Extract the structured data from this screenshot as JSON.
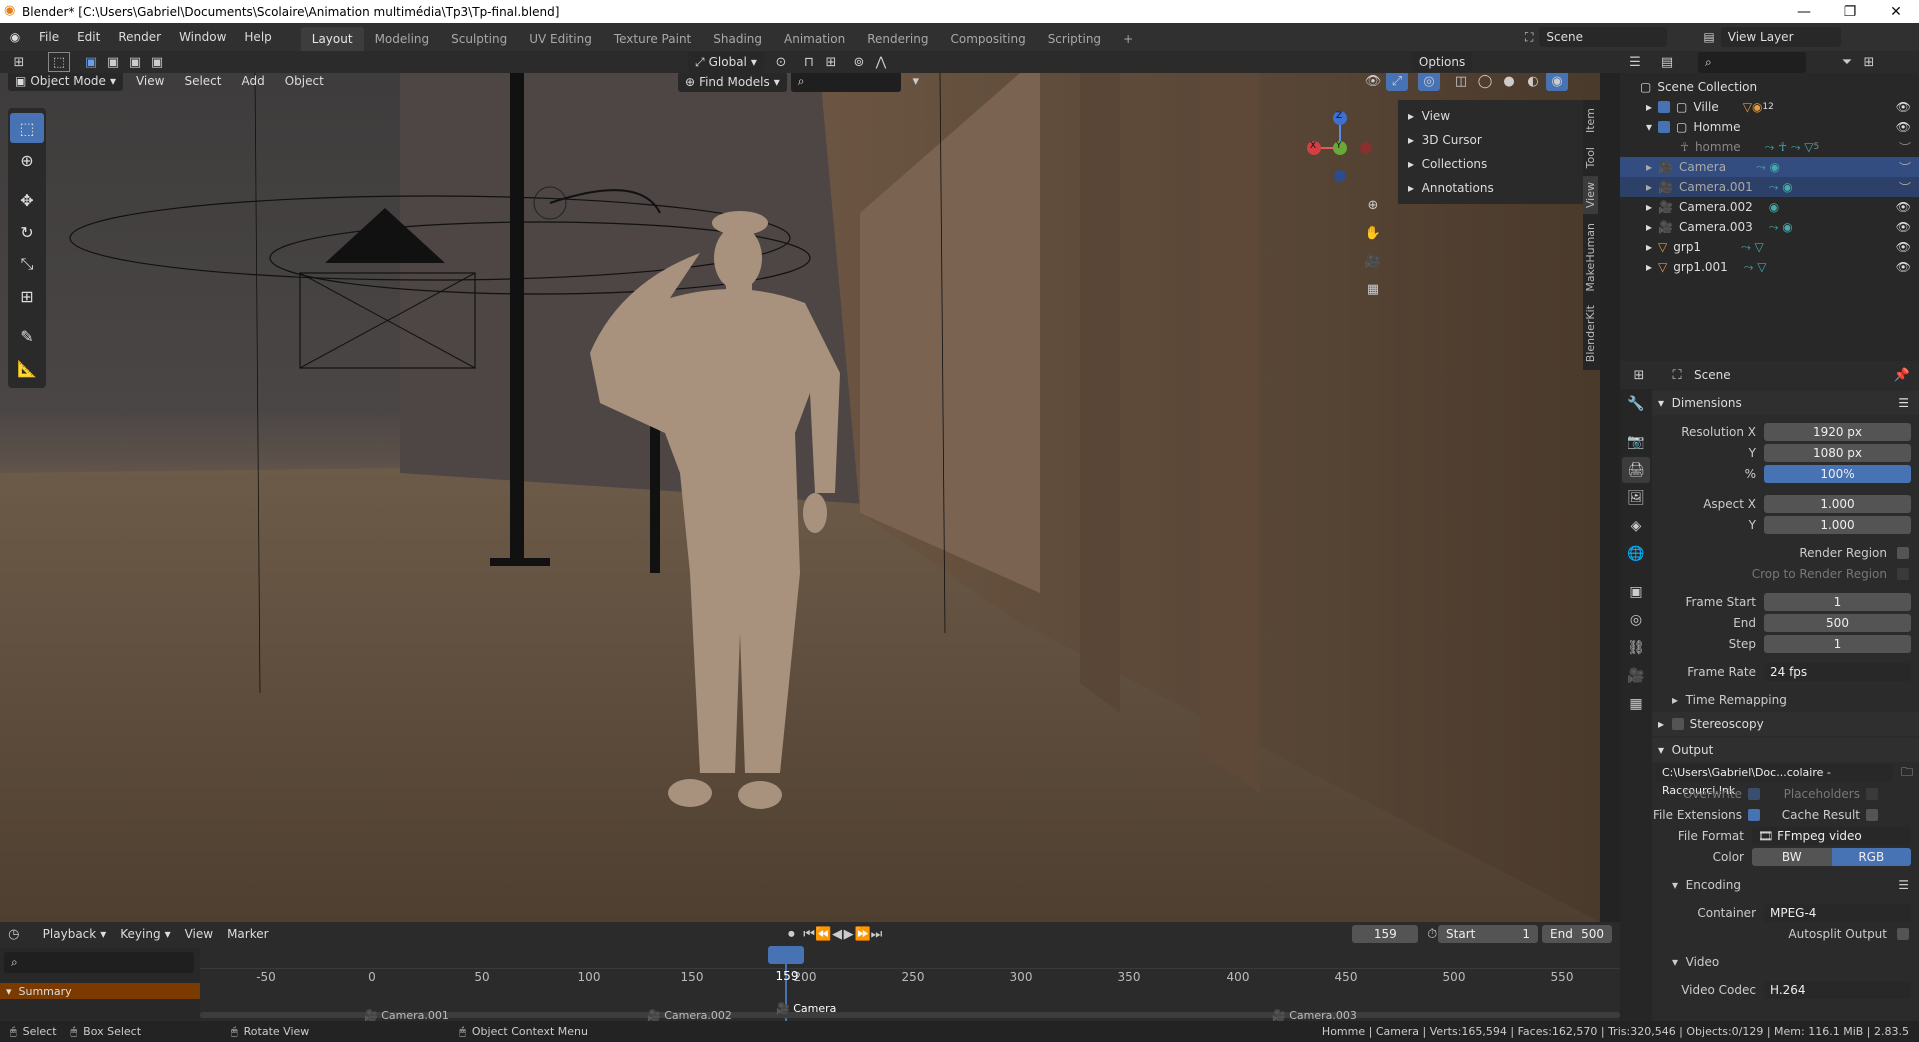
{
  "window": {
    "title": "Blender* [C:\\Users\\Gabriel\\Documents\\Scolaire\\Animation multimédia\\Tp3\\Tp-final.blend]",
    "min": "—",
    "max": "❐",
    "close": "✕"
  },
  "menu": {
    "items": [
      "File",
      "Edit",
      "Render",
      "Window",
      "Help"
    ]
  },
  "workspaces": {
    "tabs": [
      "Layout",
      "Modeling",
      "Sculpting",
      "UV Editing",
      "Texture Paint",
      "Shading",
      "Animation",
      "Rendering",
      "Compositing",
      "Scripting"
    ],
    "add": "+"
  },
  "topright": {
    "scene": "Scene",
    "view_layer": "View Layer"
  },
  "viewport_header": {
    "orientation": "Global",
    "options": "Options",
    "mode": "Object Mode",
    "menus": [
      "View",
      "Select",
      "Add",
      "Object"
    ],
    "find": "Find Models"
  },
  "npanel": {
    "items": [
      "View",
      "3D Cursor",
      "Collections",
      "Annotations"
    ],
    "tabs": [
      "Item",
      "Tool",
      "View",
      "MakeHuman",
      "BlenderKit"
    ]
  },
  "outliner": {
    "root": "Scene Collection",
    "rows": [
      {
        "name": "Ville",
        "extra": "12"
      },
      {
        "name": "Homme",
        "extra": ""
      },
      {
        "name": "homme",
        "extra": "5"
      },
      {
        "name": "Camera",
        "extra": ""
      },
      {
        "name": "Camera.001",
        "extra": ""
      },
      {
        "name": "Camera.002",
        "extra": ""
      },
      {
        "name": "Camera.003",
        "extra": ""
      },
      {
        "name": "grp1",
        "extra": ""
      },
      {
        "name": "grp1.001",
        "extra": ""
      }
    ]
  },
  "properties": {
    "context": "Scene",
    "dimensions": {
      "title": "Dimensions",
      "res_x_label": "Resolution X",
      "res_x": "1920 px",
      "res_y_label": "Y",
      "res_y": "1080 px",
      "pct_label": "%",
      "pct": "100%",
      "aspect_x_label": "Aspect X",
      "aspect_x": "1.000",
      "aspect_y_label": "Y",
      "aspect_y": "1.000",
      "render_region": "Render Region",
      "crop": "Crop to Render Region",
      "frame_start_label": "Frame Start",
      "frame_start": "1",
      "end_label": "End",
      "end": "500",
      "step_label": "Step",
      "step": "1",
      "frame_rate_label": "Frame Rate",
      "frame_rate": "24 fps",
      "time_remap": "Time Remapping"
    },
    "stereoscopy": "Stereoscopy",
    "output": {
      "title": "Output",
      "path": "C:\\Users\\Gabriel\\Doc...colaire - Raccourci.lnk",
      "overwrite": "Overwrite",
      "placeholders": "Placeholders",
      "file_ext": "File Extensions",
      "cache": "Cache Result",
      "file_format_label": "File Format",
      "file_format": "FFmpeg video",
      "color_label": "Color",
      "bw": "BW",
      "rgb": "RGB"
    },
    "encoding": {
      "title": "Encoding",
      "container_label": "Container",
      "container": "MPEG-4",
      "autosplit": "Autosplit Output"
    },
    "video": {
      "title": "Video",
      "codec_label": "Video Codec",
      "codec": "H.264"
    }
  },
  "timeline": {
    "menus": [
      "Playback",
      "Keying",
      "View",
      "Marker"
    ],
    "current": "159",
    "start_label": "Start",
    "start": "1",
    "end_label": "End",
    "end": "500",
    "ticks": [
      "-50",
      "0",
      "50",
      "100",
      "150",
      "200",
      "250",
      "300",
      "350",
      "400",
      "450",
      "500",
      "550"
    ],
    "summary": "Summary",
    "markers": [
      "Camera.001",
      "Camera.002",
      "Camera",
      "Camera.003"
    ]
  },
  "status": {
    "select": "Select",
    "box_select": "Box Select",
    "rotate": "Rotate View",
    "context_menu": "Object Context Menu",
    "info": "Homme | Camera | Verts:165,594 | Faces:162,570 | Tris:320,546 | Objects:0/129 | Mem: 116.1 MiB | 2.83.5"
  },
  "gizmo": {
    "z": "Z",
    "x": "X",
    "y": "Y"
  },
  "colors": {
    "accent": "#4772b3",
    "header": "#303030",
    "panel": "#2b2b2b"
  }
}
